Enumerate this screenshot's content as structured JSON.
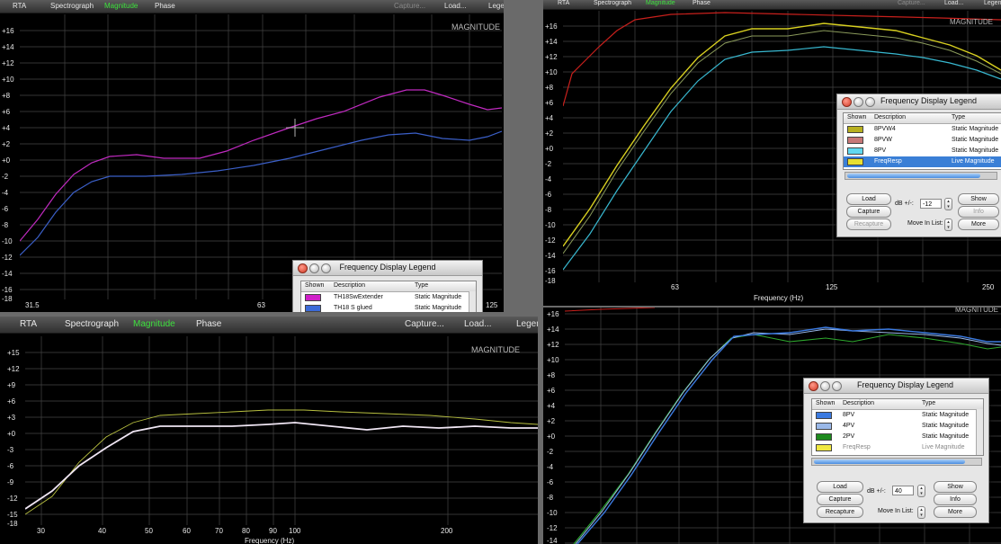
{
  "tabs": [
    "RTA",
    "Spectrograph",
    "Magnitude",
    "Phase"
  ],
  "toolbar": {
    "capture": "Capture...",
    "load": "Load...",
    "legend": "Legend"
  },
  "panel_label": "MAGNITUDE",
  "colors": {
    "magenta": "#c02ac0",
    "blue": "#3b5fc8",
    "red": "#c8201c",
    "yellow": "#d8d020",
    "cyan": "#38b8d0",
    "green": "#2ea82e",
    "white": "#f0e6f4",
    "olive": "#b8c040",
    "grid": "#4a4a4a",
    "highlight": "#3ee13e"
  },
  "icons": [
    "close-icon",
    "minimize-icon",
    "zoom-icon",
    "stepper-icon"
  ],
  "panels": [
    {
      "id": "tl",
      "y_ticks": [
        "+16",
        "+14",
        "+12",
        "+10",
        "+8",
        "+6",
        "+4",
        "+2",
        "+0",
        "-2",
        "-4",
        "-6",
        "-8",
        "-10",
        "-12",
        "-14",
        "-16",
        "-18"
      ],
      "x_ticks": [
        "31.5",
        "63",
        "125"
      ],
      "x_title": "",
      "legend": {
        "title": "Frequency Display Legend",
        "headers": {
          "shown": "Shown",
          "description": "Description",
          "type": "Type"
        },
        "rows": [
          {
            "description": "TH18SwExtender",
            "type": "Static Magnitude",
            "color": "#d020c8"
          },
          {
            "description": "TH18 S glued",
            "type": "Static Magnitude",
            "color": "#3b6ad8"
          }
        ]
      }
    },
    {
      "id": "tr",
      "y_ticks": [
        "+16",
        "+14",
        "+12",
        "+10",
        "+8",
        "+6",
        "+4",
        "+2",
        "+0",
        "-2",
        "-4",
        "-6",
        "-8",
        "-10",
        "-12",
        "-14",
        "-16",
        "-18"
      ],
      "x_ticks": [
        "63",
        "125",
        "250"
      ],
      "x_title": "Frequency (Hz)",
      "legend": {
        "title": "Frequency Display Legend",
        "headers": {
          "shown": "Shown",
          "description": "Description",
          "type": "Type"
        },
        "rows": [
          {
            "description": "8PVW4",
            "type": "Static Magnitude",
            "color": "#b8b020"
          },
          {
            "description": "8PVW",
            "type": "Static Magnitude",
            "color": "#c87878"
          },
          {
            "description": "8PV",
            "type": "Static Magnitude",
            "color": "#60d8f0"
          },
          {
            "description": "FreqResp",
            "type": "Live Magnitude",
            "color": "#e8e030"
          }
        ],
        "buttons": {
          "load": "Load",
          "capture": "Capture",
          "recapture": "Recapture",
          "show": "Show",
          "info": "Info",
          "more": "More"
        },
        "db_label": "dB +/-:",
        "db_value": "-12",
        "move_label": "Move In List:"
      }
    },
    {
      "id": "bl",
      "y_ticks": [
        "+15",
        "+12",
        "+9",
        "+6",
        "+3",
        "+0",
        "-3",
        "-6",
        "-9",
        "-12",
        "-15",
        "-18"
      ],
      "x_ticks": [
        "30",
        "40",
        "50",
        "60",
        "70",
        "80",
        "90",
        "100",
        "200"
      ],
      "x_title": "Frequency (Hz)",
      "tabs_extra": {
        "capture": "Capture...",
        "load": "Load...",
        "legend": "Legen"
      }
    },
    {
      "id": "br",
      "y_ticks": [
        "+16",
        "+14",
        "+12",
        "+10",
        "+8",
        "+6",
        "+4",
        "+2",
        "+0",
        "-2",
        "-4",
        "-6",
        "-8",
        "-10",
        "-12",
        "-14"
      ],
      "legend": {
        "title": "Frequency Display Legend",
        "headers": {
          "shown": "Shown",
          "description": "Description",
          "type": "Type"
        },
        "rows": [
          {
            "description": "8PV",
            "type": "Static Magnitude",
            "color": "#3b7ae0"
          },
          {
            "description": "4PV",
            "type": "Static Magnitude",
            "color": "#9ab8e8"
          },
          {
            "description": "2PV",
            "type": "Static Magnitude",
            "color": "#1e8a1e"
          },
          {
            "description": "FreqResp",
            "type": "Live Magnitude",
            "color": "#f0e840"
          }
        ],
        "buttons": {
          "load": "Load",
          "capture": "Capture",
          "recapture": "Recapture",
          "show": "Show",
          "info": "Info",
          "more": "More"
        },
        "db_label": "dB +/-:",
        "db_value": "40",
        "move_label": "Move In List:"
      }
    }
  ]
}
